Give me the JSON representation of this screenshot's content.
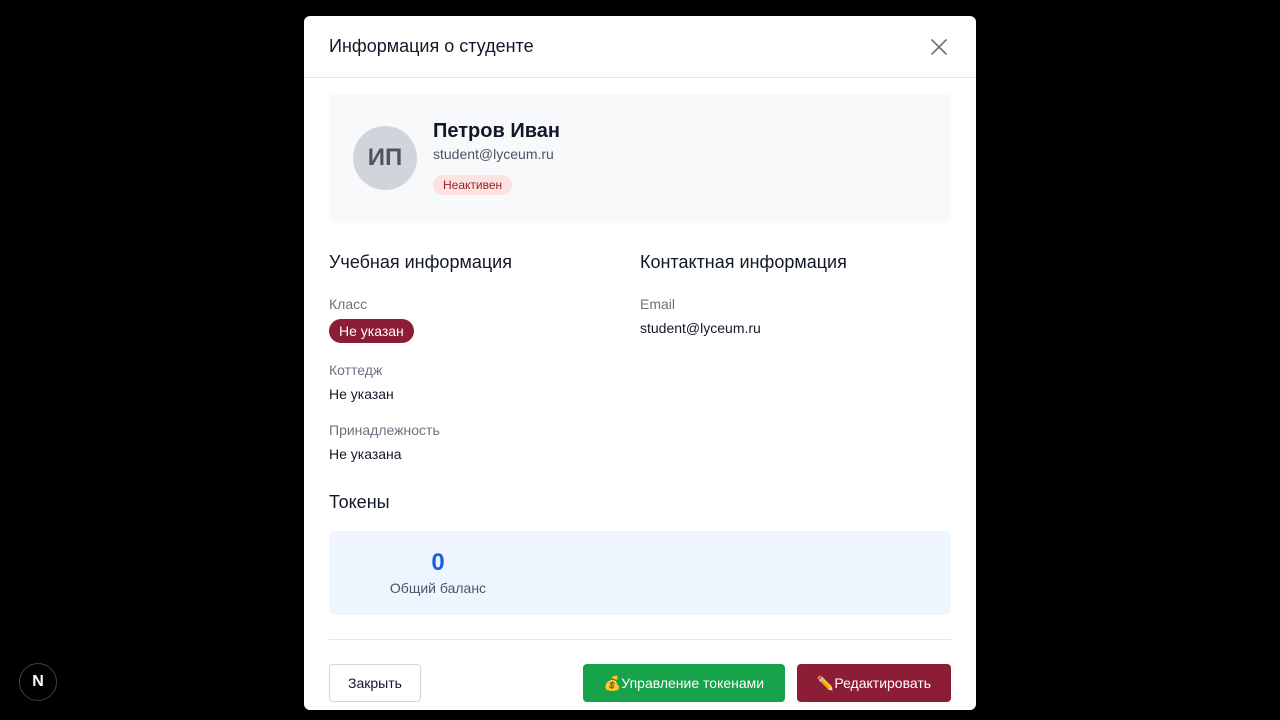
{
  "modal": {
    "title": "Информация о студенте",
    "close_icon": "close-icon"
  },
  "profile": {
    "initials": "ИП",
    "name": "Петров Иван",
    "email": "student@lyceum.ru",
    "status": "Неактивен"
  },
  "academic": {
    "title": "Учебная информация",
    "class_label": "Класс",
    "class_value": "Не указан",
    "cottage_label": "Коттедж",
    "cottage_value": "Не указан",
    "affiliation_label": "Принадлежность",
    "affiliation_value": "Не указана"
  },
  "contact": {
    "title": "Контактная информация",
    "email_label": "Email",
    "email_value": "student@lyceum.ru"
  },
  "tokens": {
    "title": "Токены",
    "balance_value": "0",
    "balance_label": "Общий баланс"
  },
  "footer": {
    "close_label": "Закрыть",
    "manage_tokens_label": "💰Управление токенами",
    "edit_label": "✏️Редактировать"
  },
  "dev_badge": {
    "letter": "N"
  },
  "colors": {
    "accent": "#8b1e35",
    "success": "#16a34a",
    "token_blue": "#1d5fe0"
  }
}
